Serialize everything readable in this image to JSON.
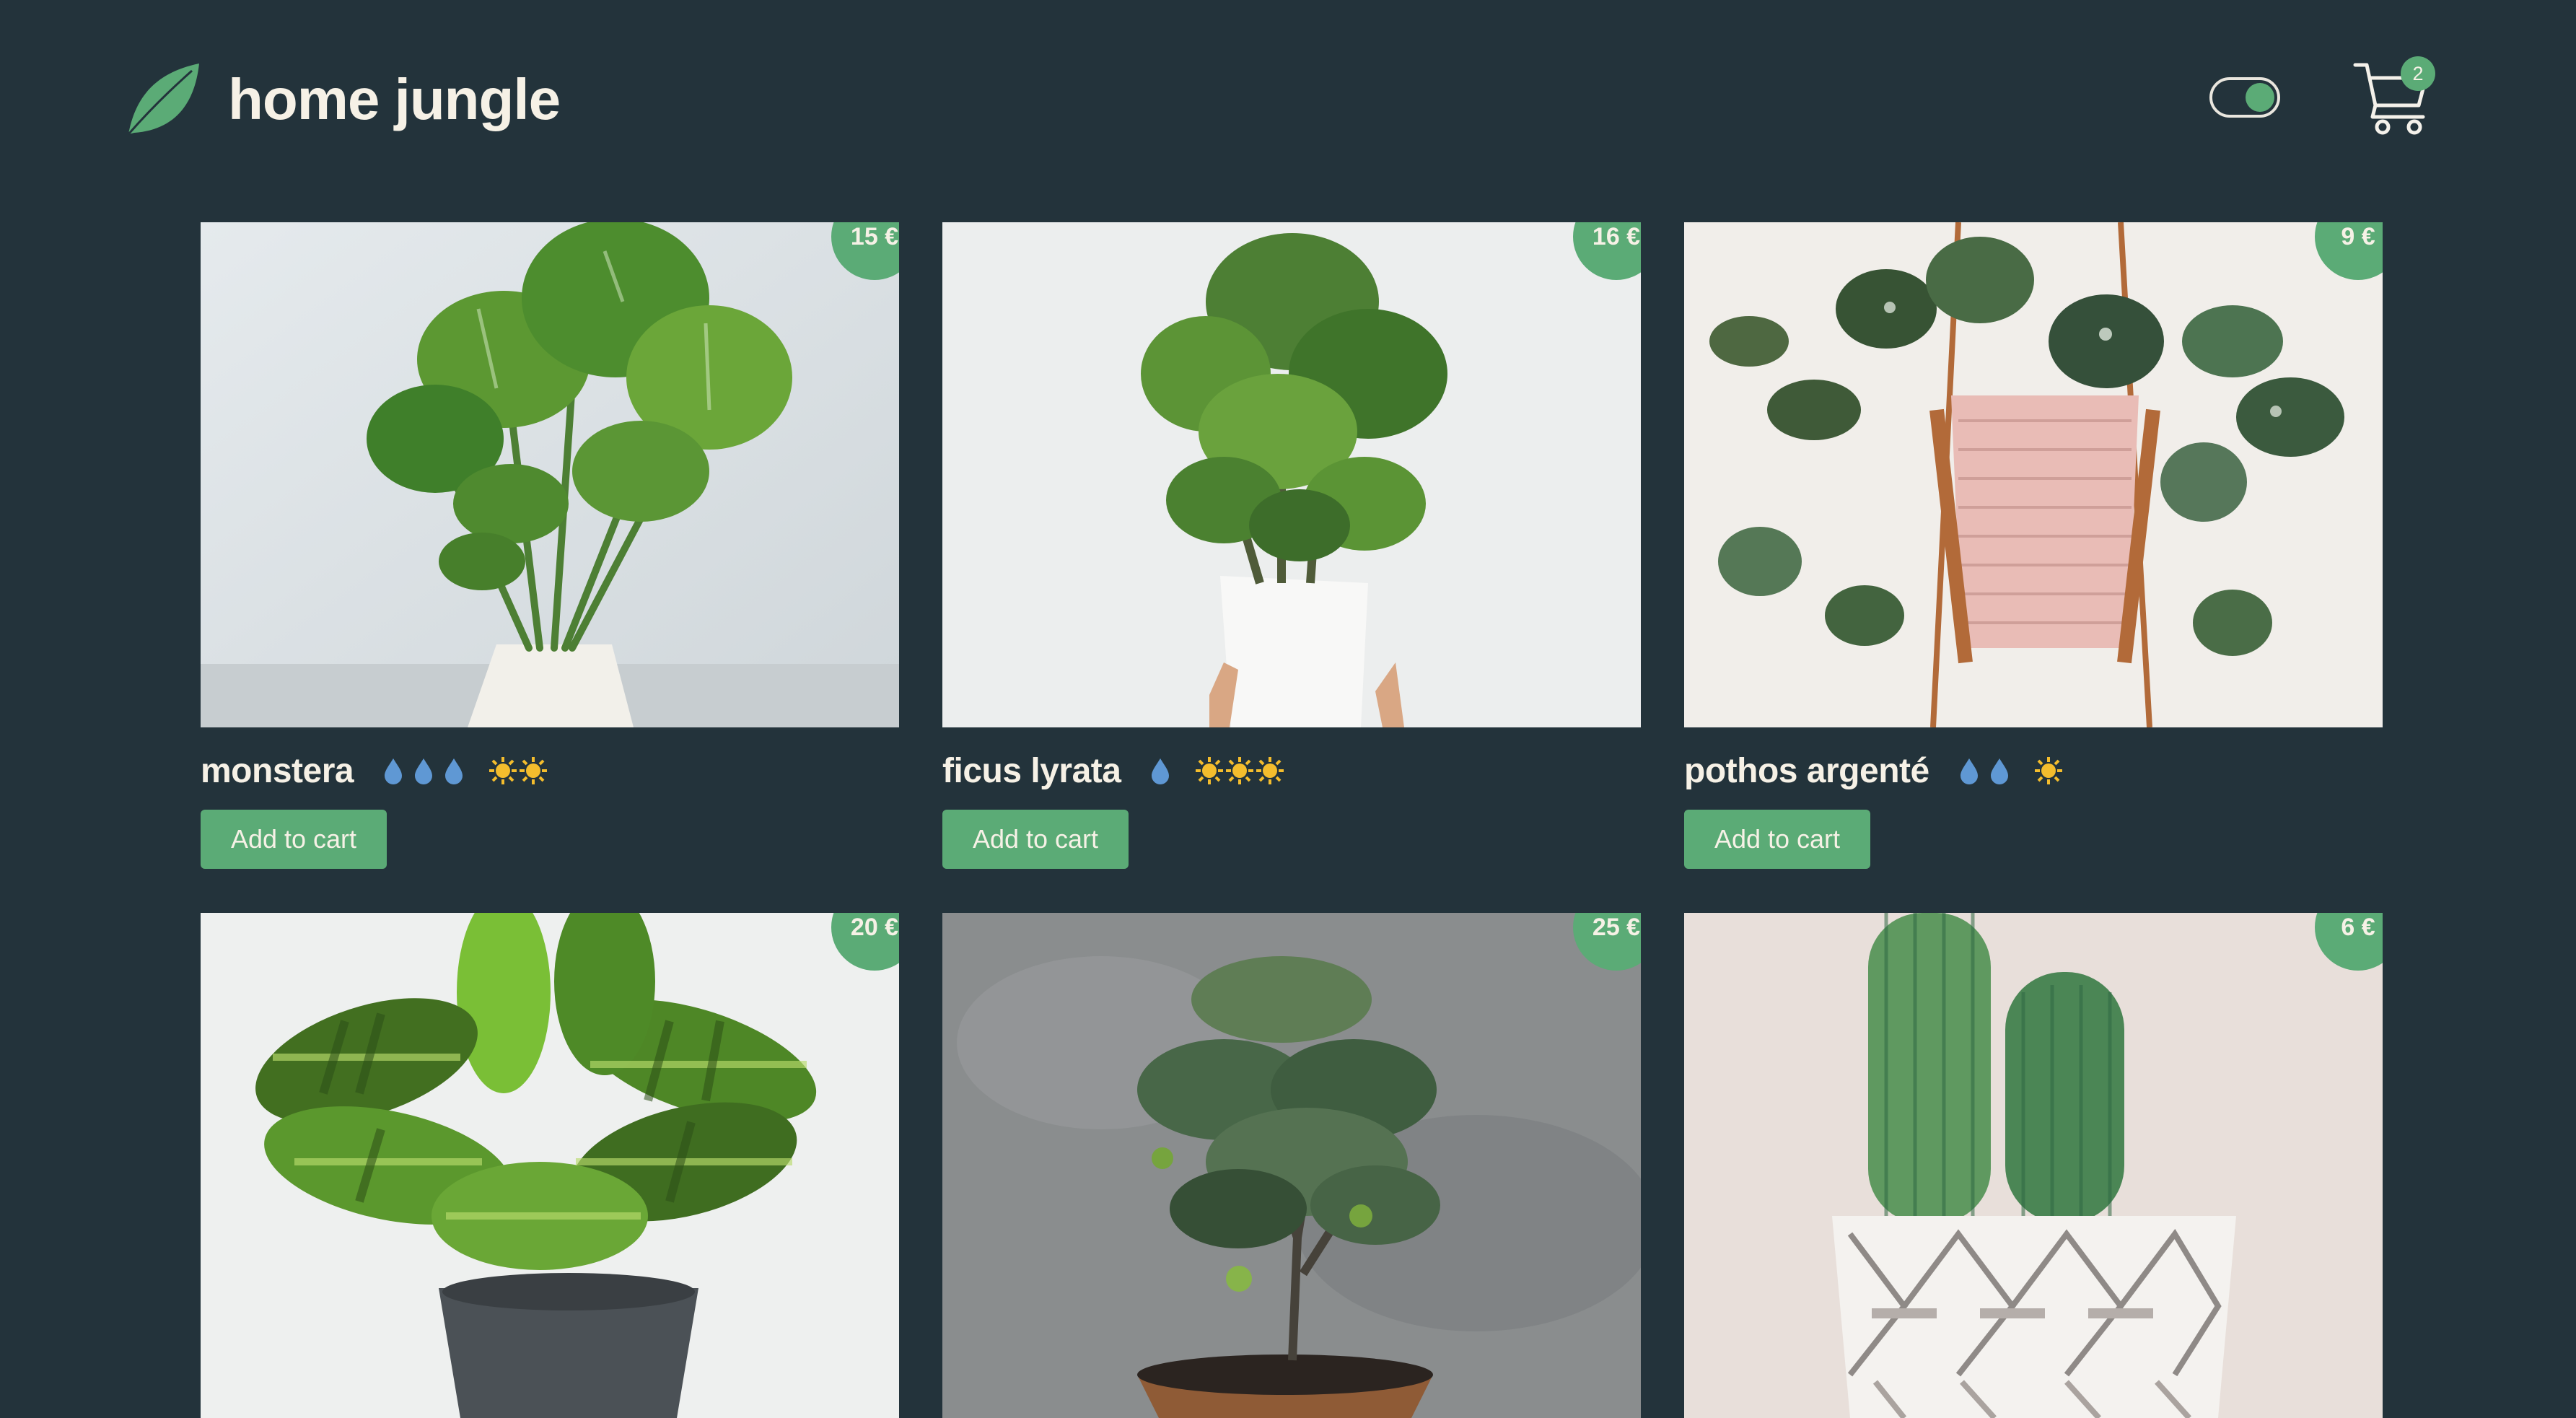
{
  "header": {
    "logo_icon": "leaf-icon",
    "brand": "home jungle",
    "theme_toggle": "on",
    "cart_icon": "cart-icon",
    "cart_count": "2"
  },
  "colors": {
    "background": "#23333b",
    "accent": "#5bab76",
    "text": "#f6f1e6",
    "water": "#5f98d4",
    "sun": "#f4bd2d"
  },
  "products": [
    {
      "name": "monstera",
      "price": "15 €",
      "water": 3,
      "light": 2,
      "button": "Add to cart"
    },
    {
      "name": "ficus lyrata",
      "price": "16 €",
      "water": 1,
      "light": 3,
      "button": "Add to cart"
    },
    {
      "name": "pothos argenté",
      "price": "9 €",
      "water": 2,
      "light": 1,
      "button": "Add to cart"
    },
    {
      "name": "",
      "price": "20 €",
      "button": ""
    },
    {
      "name": "",
      "price": "25 €",
      "button": ""
    },
    {
      "name": "",
      "price": "6 €",
      "button": ""
    }
  ]
}
